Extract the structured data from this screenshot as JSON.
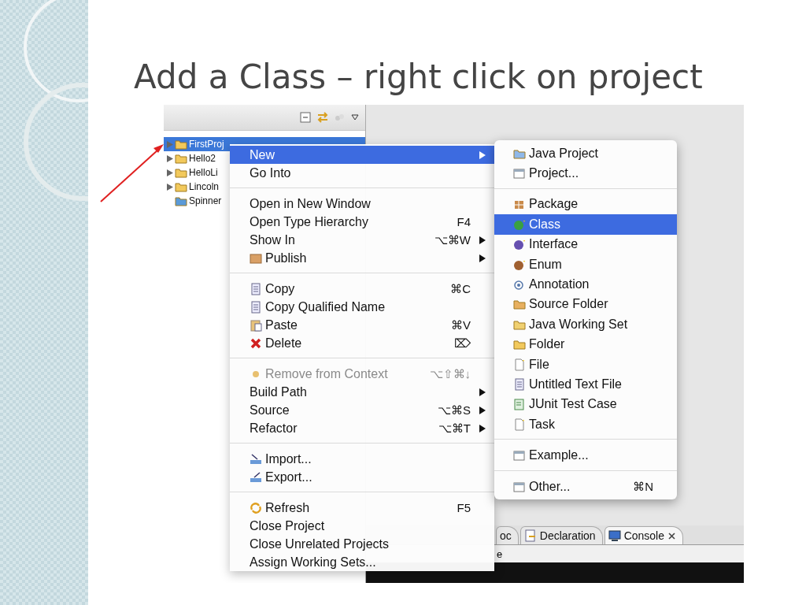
{
  "slide_title": "Add a Class – right click on project",
  "tree": [
    {
      "label": "FirstProj",
      "expandable": true,
      "selected": true
    },
    {
      "label": "Hello2",
      "expandable": true,
      "selected": false
    },
    {
      "label": "HelloLi",
      "expandable": true,
      "selected": false
    },
    {
      "label": "Lincoln",
      "expandable": true,
      "selected": false
    },
    {
      "label": "Spinner",
      "expandable": false,
      "selected": false
    }
  ],
  "context_menu": [
    [
      {
        "label": "New",
        "submenu": true,
        "disabled": false,
        "selected": true
      },
      {
        "label": "Go Into",
        "submenu": false,
        "disabled": false,
        "selected": false
      }
    ],
    [
      {
        "label": "Open in New Window",
        "submenu": false,
        "disabled": false,
        "selected": false
      },
      {
        "label": "Open Type Hierarchy",
        "shortcut": "F4",
        "submenu": false,
        "disabled": false,
        "selected": false
      },
      {
        "label": "Show In",
        "shortcut": "⌥⌘W",
        "submenu": true,
        "disabled": false,
        "selected": false
      },
      {
        "label": "Publish",
        "submenu": true,
        "disabled": false,
        "selected": false
      }
    ],
    [
      {
        "label": "Copy",
        "shortcut": "⌘C",
        "submenu": false,
        "disabled": false,
        "selected": false
      },
      {
        "label": "Copy Qualified Name",
        "submenu": false,
        "disabled": false,
        "selected": false
      },
      {
        "label": "Paste",
        "shortcut": "⌘V",
        "submenu": false,
        "disabled": false,
        "selected": false
      },
      {
        "label": "Delete",
        "shortcut": "⌦",
        "submenu": false,
        "disabled": false,
        "selected": false
      }
    ],
    [
      {
        "label": "Remove from Context",
        "shortcut": "⌥⇧⌘↓",
        "submenu": false,
        "disabled": true,
        "selected": false
      },
      {
        "label": "Build Path",
        "submenu": true,
        "disabled": false,
        "selected": false
      },
      {
        "label": "Source",
        "shortcut": "⌥⌘S",
        "submenu": true,
        "disabled": false,
        "selected": false
      },
      {
        "label": "Refactor",
        "shortcut": "⌥⌘T",
        "submenu": true,
        "disabled": false,
        "selected": false
      }
    ],
    [
      {
        "label": "Import...",
        "submenu": false,
        "disabled": false,
        "selected": false
      },
      {
        "label": "Export...",
        "submenu": false,
        "disabled": false,
        "selected": false
      }
    ],
    [
      {
        "label": "Refresh",
        "shortcut": "F5",
        "submenu": false,
        "disabled": false,
        "selected": false
      },
      {
        "label": "Close Project",
        "submenu": false,
        "disabled": false,
        "selected": false
      },
      {
        "label": "Close Unrelated Projects",
        "submenu": false,
        "disabled": false,
        "selected": false
      },
      {
        "label": "Assign Working Sets...",
        "submenu": false,
        "disabled": false,
        "selected": false
      }
    ]
  ],
  "new_submenu": [
    [
      {
        "label": "Java Project",
        "selected": false
      },
      {
        "label": "Project...",
        "selected": false
      }
    ],
    [
      {
        "label": "Package",
        "selected": false
      },
      {
        "label": "Class",
        "selected": true
      },
      {
        "label": "Interface",
        "selected": false
      },
      {
        "label": "Enum",
        "selected": false
      },
      {
        "label": "Annotation",
        "selected": false
      },
      {
        "label": "Source Folder",
        "selected": false
      },
      {
        "label": "Java Working Set",
        "selected": false
      },
      {
        "label": "Folder",
        "selected": false
      },
      {
        "label": "File",
        "selected": false
      },
      {
        "label": "Untitled Text File",
        "selected": false
      },
      {
        "label": "JUnit Test Case",
        "selected": false
      },
      {
        "label": "Task",
        "selected": false
      }
    ],
    [
      {
        "label": "Example...",
        "selected": false
      }
    ],
    [
      {
        "label": "Other...",
        "shortcut": "⌘N",
        "selected": false
      }
    ]
  ],
  "bottom_tabs": [
    {
      "label": "oc",
      "selected": false,
      "closable": false
    },
    {
      "label": "Declaration",
      "selected": false,
      "closable": false
    },
    {
      "label": "Console",
      "selected": true,
      "closable": true
    }
  ],
  "console_header": "e"
}
